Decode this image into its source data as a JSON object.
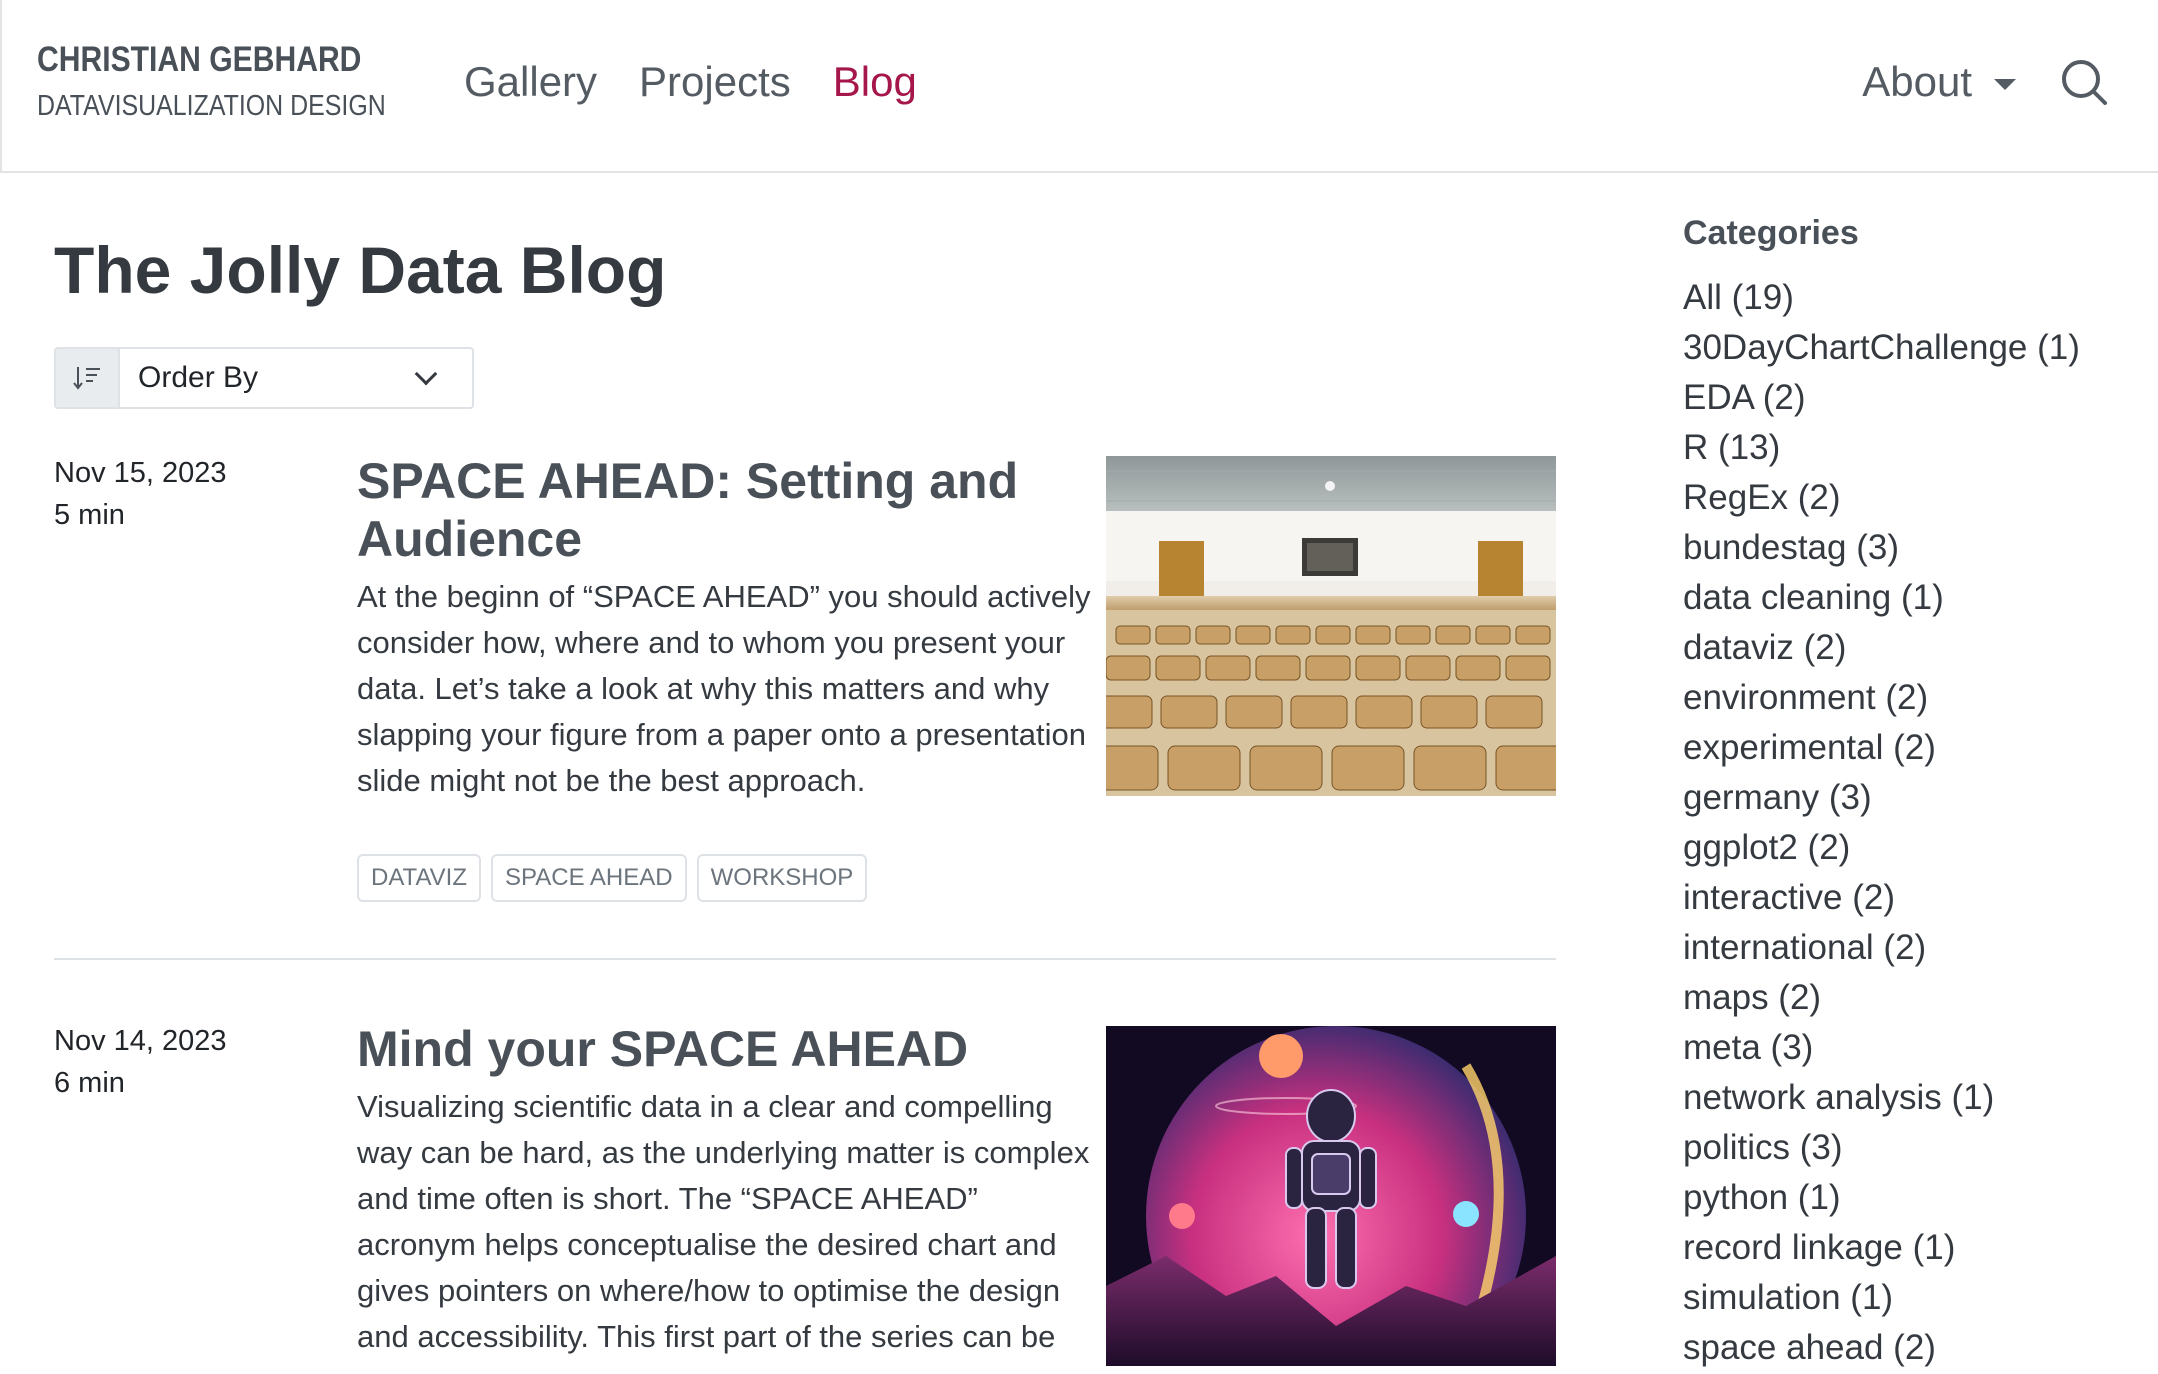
{
  "brand": {
    "title": "CHRISTIAN GEBHARD",
    "subtitle": "DATAVISUALIZATION DESIGN"
  },
  "nav": {
    "links": [
      {
        "label": "Gallery",
        "active": false
      },
      {
        "label": "Projects",
        "active": false
      },
      {
        "label": "Blog",
        "active": true
      }
    ],
    "about_label": "About",
    "search_icon": "search-icon",
    "accent_color": "#a5164a"
  },
  "page": {
    "title": "The Jolly Data Blog",
    "order_by": {
      "selected": "Order By",
      "icon": "sort-icon"
    }
  },
  "posts": [
    {
      "date": "Nov 15, 2023",
      "read_time": "5 min",
      "title": "SPACE AHEAD: Setting and Audience",
      "description": "At the beginn of “SPACE AHEAD” you should actively consider how, where and to whom you present your data. Let’s take a look at why this matters and why slapping your figure from a paper onto a presentation slide might not be the best approach.",
      "tags": [
        "DATAVIZ",
        "SPACE AHEAD",
        "WORKSHOP"
      ],
      "image": "lecture-hall-image"
    },
    {
      "date": "Nov 14, 2023",
      "read_time": "6 min",
      "title": "Mind your SPACE AHEAD",
      "description": "Visualizing scientific data in a clear and compelling way can be hard, as the underlying matter is complex and time often is short. The “SPACE AHEAD” acronym helps conceptualise the desired chart and gives pointers on where/how to optimise the design and accessibility. This first part of the series can be",
      "image": "astronaut-planet-image"
    }
  ],
  "sidebar": {
    "title": "Categories",
    "categories": [
      "All (19)",
      "30DayChartChallenge (1)",
      "EDA (2)",
      "R (13)",
      "RegEx (2)",
      "bundestag (3)",
      "data cleaning (1)",
      "dataviz (2)",
      "environment (2)",
      "experimental (2)",
      "germany (3)",
      "ggplot2 (2)",
      "interactive (2)",
      "international (2)",
      "maps (2)",
      "meta (3)",
      "network analysis (1)",
      "politics (3)",
      "python (1)",
      "record linkage (1)",
      "simulation (1)",
      "space ahead (2)"
    ]
  }
}
